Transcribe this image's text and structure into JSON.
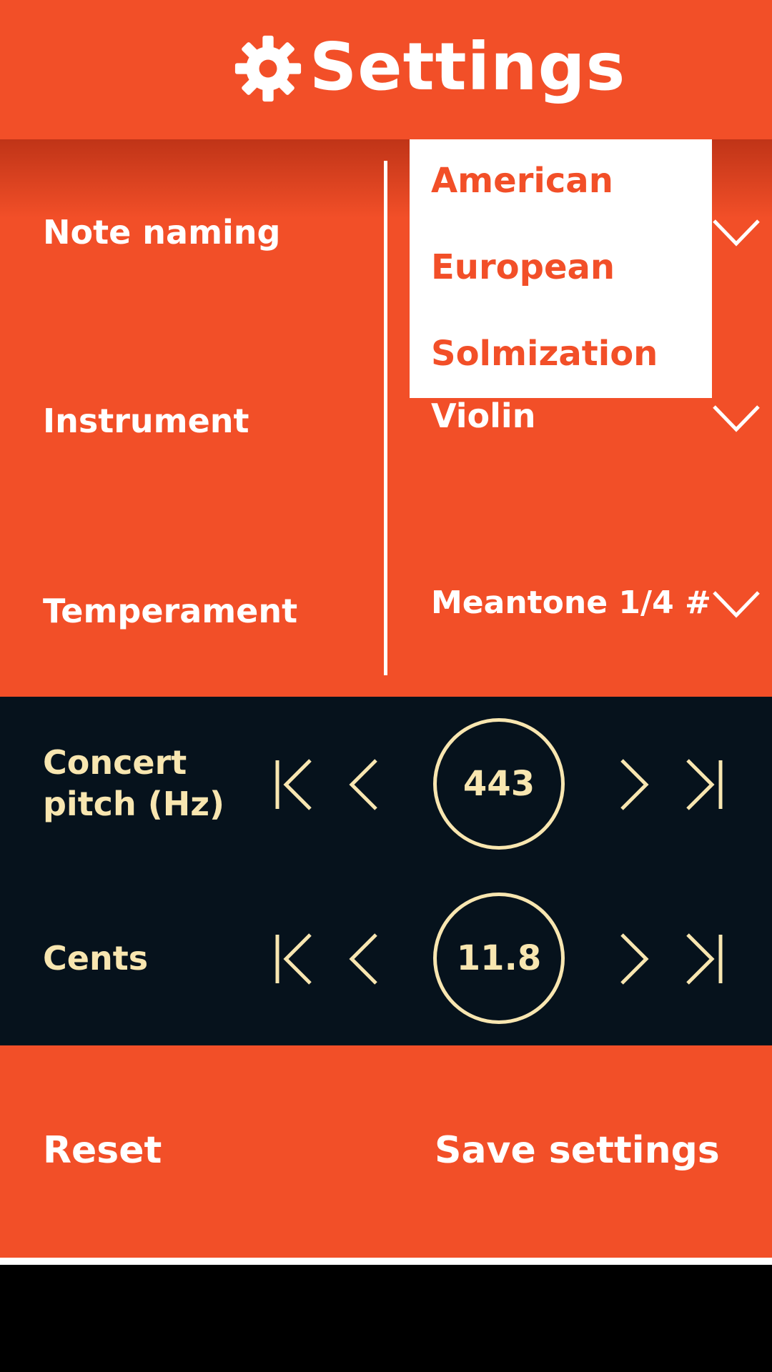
{
  "header": {
    "title": "Settings",
    "icon": "gear-icon"
  },
  "settings": {
    "note_naming": {
      "label": "Note naming"
    },
    "instrument": {
      "label": "Instrument",
      "value": "Violin"
    },
    "temperament": {
      "label": "Temperament",
      "value": "Meantone 1/4 #"
    }
  },
  "dropdown": {
    "options": [
      "American",
      "European",
      "Solmization"
    ]
  },
  "concert_pitch": {
    "label_line1": "Concert",
    "label_line2": "pitch (Hz)",
    "value": "443"
  },
  "cents": {
    "label": "Cents",
    "value": "11.8"
  },
  "actions": {
    "reset": "Reset",
    "save": "Save settings"
  },
  "colors": {
    "accent": "#F24F28",
    "dark": "#06121C",
    "cream": "#F8E6B0"
  }
}
